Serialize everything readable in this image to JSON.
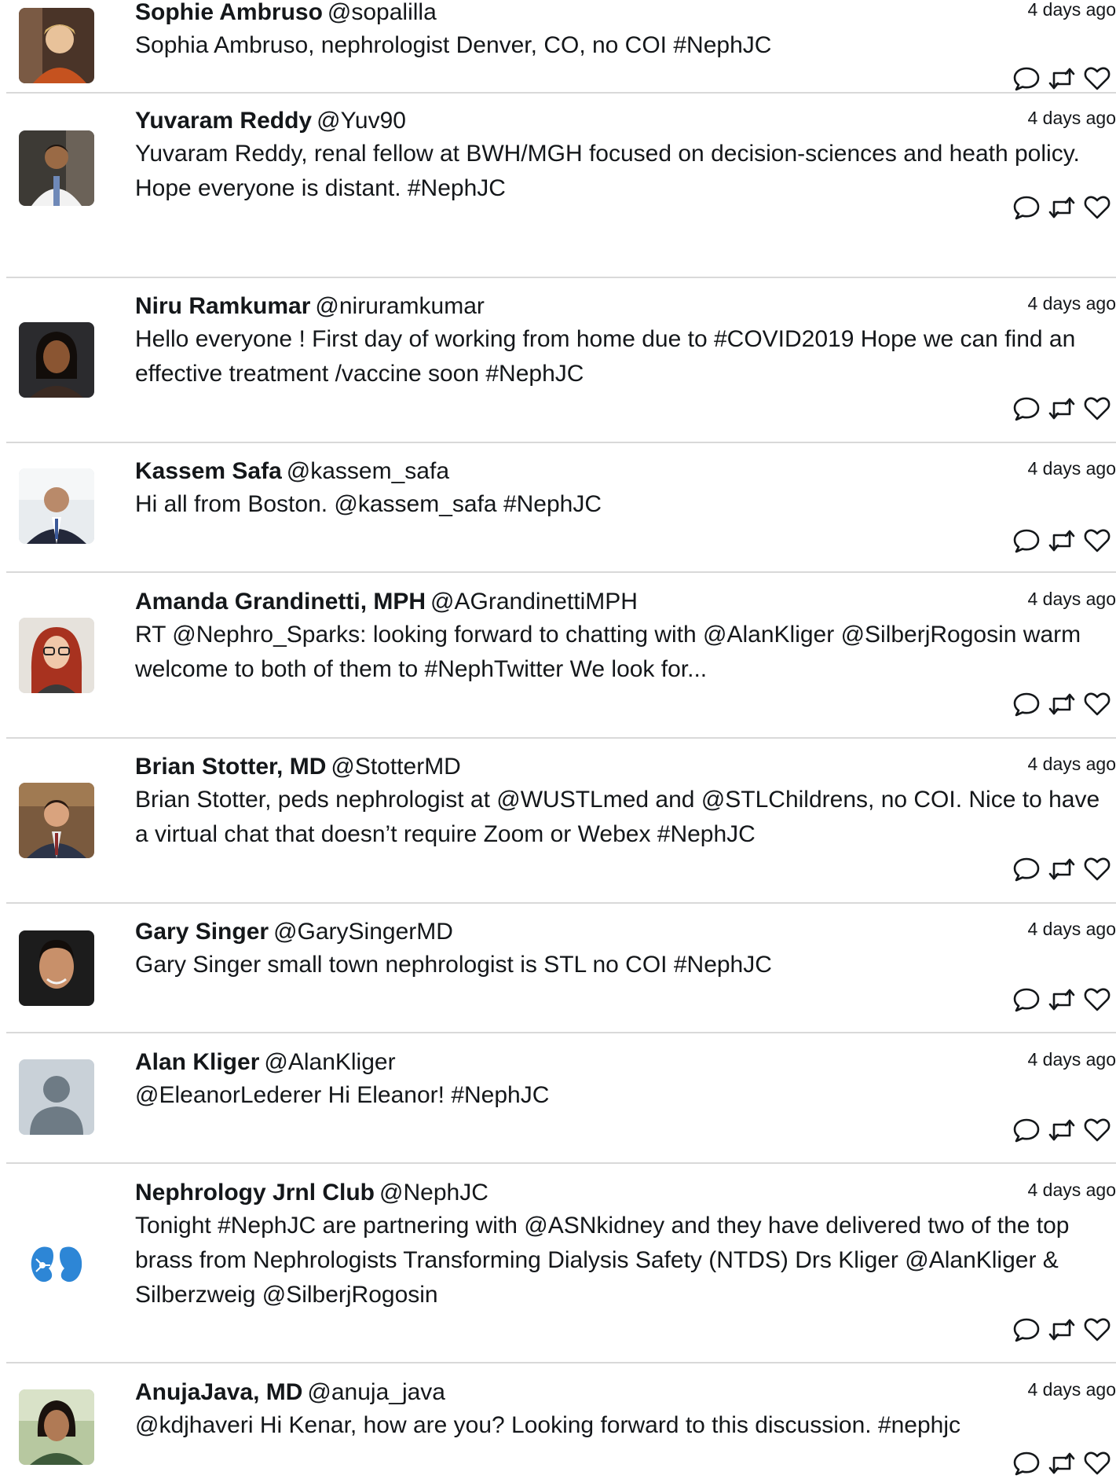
{
  "tweets": [
    {
      "name": "Sophie Ambruso",
      "handle": "@sopalilla",
      "time": "4 days ago",
      "text": "Sophia Ambruso, nephrologist Denver, CO, no COI #NephJC",
      "avatar": "photo-warm-orange"
    },
    {
      "name": "Yuvaram Reddy",
      "handle": "@Yuv90",
      "time": "4 days ago",
      "text": "Yuvaram Reddy, renal fellow at BWH/MGH focused on decision-sciences and heath policy. Hope everyone is distant. #NephJC",
      "avatar": "photo-white-coat"
    },
    {
      "name": "Niru Ramkumar",
      "handle": "@niruramkumar",
      "time": "4 days ago",
      "text": "Hello everyone ! First day of working from home due to #COVID2019 Hope we can find an effective treatment /vaccine soon #NephJC",
      "avatar": "photo-dark"
    },
    {
      "name": "Kassem Safa",
      "handle": "@kassem_safa",
      "time": "4 days ago",
      "text": "Hi all from Boston. @kassem_safa #NephJC",
      "avatar": "photo-suit-grey"
    },
    {
      "name": "Amanda Grandinetti, MPH",
      "handle": "@AGrandinettiMPH",
      "time": "4 days ago",
      "text": "RT @Nephro_Sparks: looking forward to chatting with @AlanKliger @SilberjRogosin warm welcome to both of them to #NephTwitter We look for...",
      "avatar": "photo-red-hair"
    },
    {
      "name": "Brian Stotter, MD",
      "handle": "@StotterMD",
      "time": "4 days ago",
      "text": "Brian Stotter, peds nephrologist at @WUSTLmed and @STLChildrens, no COI. Nice to have a virtual chat that doesn’t require Zoom or Webex #NephJC",
      "avatar": "photo-suit-brown"
    },
    {
      "name": "Gary Singer",
      "handle": "@GarySingerMD",
      "time": "4 days ago",
      "text": "Gary Singer small town nephrologist is STL no COI #NephJC",
      "avatar": "photo-dark-bg"
    },
    {
      "name": "Alan Kliger",
      "handle": "@AlanKliger",
      "time": "4 days ago",
      "text": "@EleanorLederer Hi Eleanor! #NephJC",
      "avatar": "default-user"
    },
    {
      "name": "Nephrology Jrnl Club",
      "handle": "@NephJC",
      "time": "4 days ago",
      "text": "Tonight #NephJC are partnering with @ASNkidney and they have delivered two of the top brass from Nephrologists Transforming Dialysis Safety (NTDS) Drs Kliger @AlanKliger & Silberzweig @SilberjRogosin",
      "avatar": "kidney-logo"
    },
    {
      "name": "AnujaJava, MD",
      "handle": "@anuja_java",
      "time": "4 days ago",
      "text": "@kdjhaveri Hi Kenar, how are you? Looking forward to this discussion. #nephjc",
      "avatar": "photo-green"
    }
  ],
  "icons": {
    "reply": "reply-icon",
    "retweet": "retweet-icon",
    "like": "like-icon"
  },
  "colors": {
    "divider": "#d9d9d9",
    "text": "#14171a",
    "kidney_logo": "#2d86d6"
  }
}
